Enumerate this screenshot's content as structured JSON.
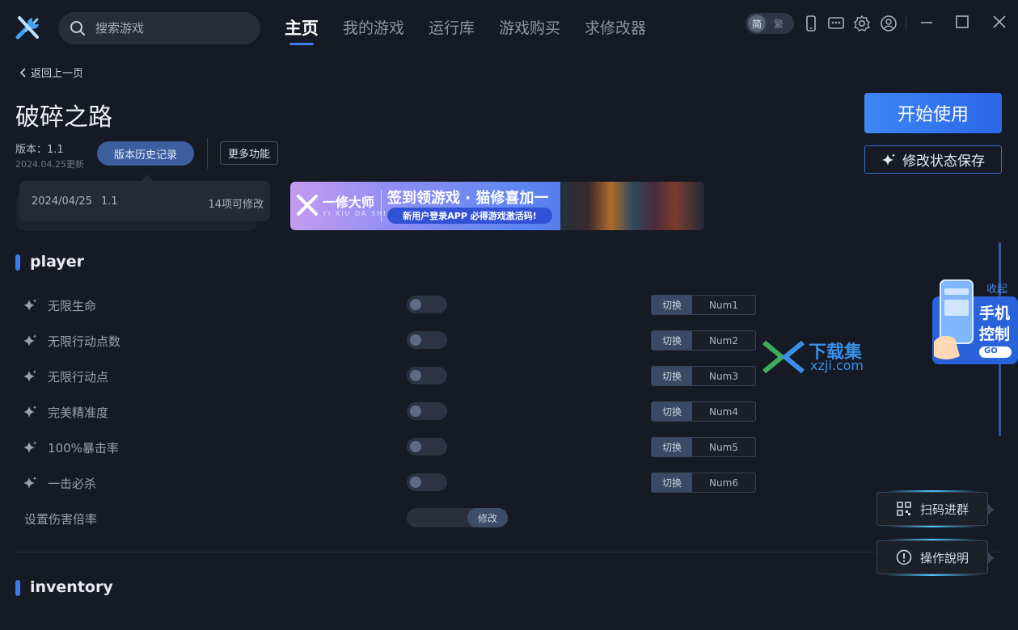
{
  "header": {
    "search_placeholder": "搜索游戏",
    "tabs": [
      {
        "label": "主页",
        "active": true
      },
      {
        "label": "我的游戏",
        "active": false
      },
      {
        "label": "运行库",
        "active": false
      },
      {
        "label": "游戏购买",
        "active": false
      },
      {
        "label": "求修改器",
        "active": false
      }
    ],
    "lang_simplified": "简",
    "lang_traditional": "繁"
  },
  "back_label": "返回上一页",
  "game": {
    "title": "破碎之路",
    "version": "版本：1.1",
    "updated": "2024.04.25更新",
    "history_button": "版本历史记录",
    "more_button": "更多功能",
    "tooltip": {
      "date": "2024/04/25",
      "version": "1.1",
      "count": "14项可修改"
    }
  },
  "banner": {
    "brand": "一修大师",
    "brand_en": "YI XIU DA SHI",
    "headline": "签到领游戏 · 猫修喜加一",
    "sub": "新用户登录APP  必得游戏激活码!"
  },
  "actions": {
    "start": "开始使用",
    "save_state": "修改状态保存"
  },
  "sections": [
    {
      "title": "player",
      "rows": [
        {
          "label": "无限生命",
          "toggle_label": "切换",
          "key": "Num1"
        },
        {
          "label": "无限行动点数",
          "toggle_label": "切换",
          "key": "Num2"
        },
        {
          "label": "无限行动点",
          "toggle_label": "切换",
          "key": "Num3"
        },
        {
          "label": "完美精准度",
          "toggle_label": "切换",
          "key": "Num4"
        },
        {
          "label": "100%暴击率",
          "toggle_label": "切换",
          "key": "Num5"
        },
        {
          "label": "一击必杀",
          "toggle_label": "切换",
          "key": "Num6"
        }
      ],
      "input_row": {
        "label": "设置伤害倍率",
        "button": "修改"
      }
    },
    {
      "title": "inventory"
    }
  ],
  "side": {
    "collapse": "收起",
    "promo_line1": "手机",
    "promo_line2": "控制",
    "promo_go": "GO",
    "watermark_cn": "下载集",
    "watermark_en": "xzji.com",
    "scan_group": "扫码进群",
    "instructions": "操作說明"
  },
  "colors": {
    "accent": "#3a7bf0",
    "background": "#151a24"
  }
}
